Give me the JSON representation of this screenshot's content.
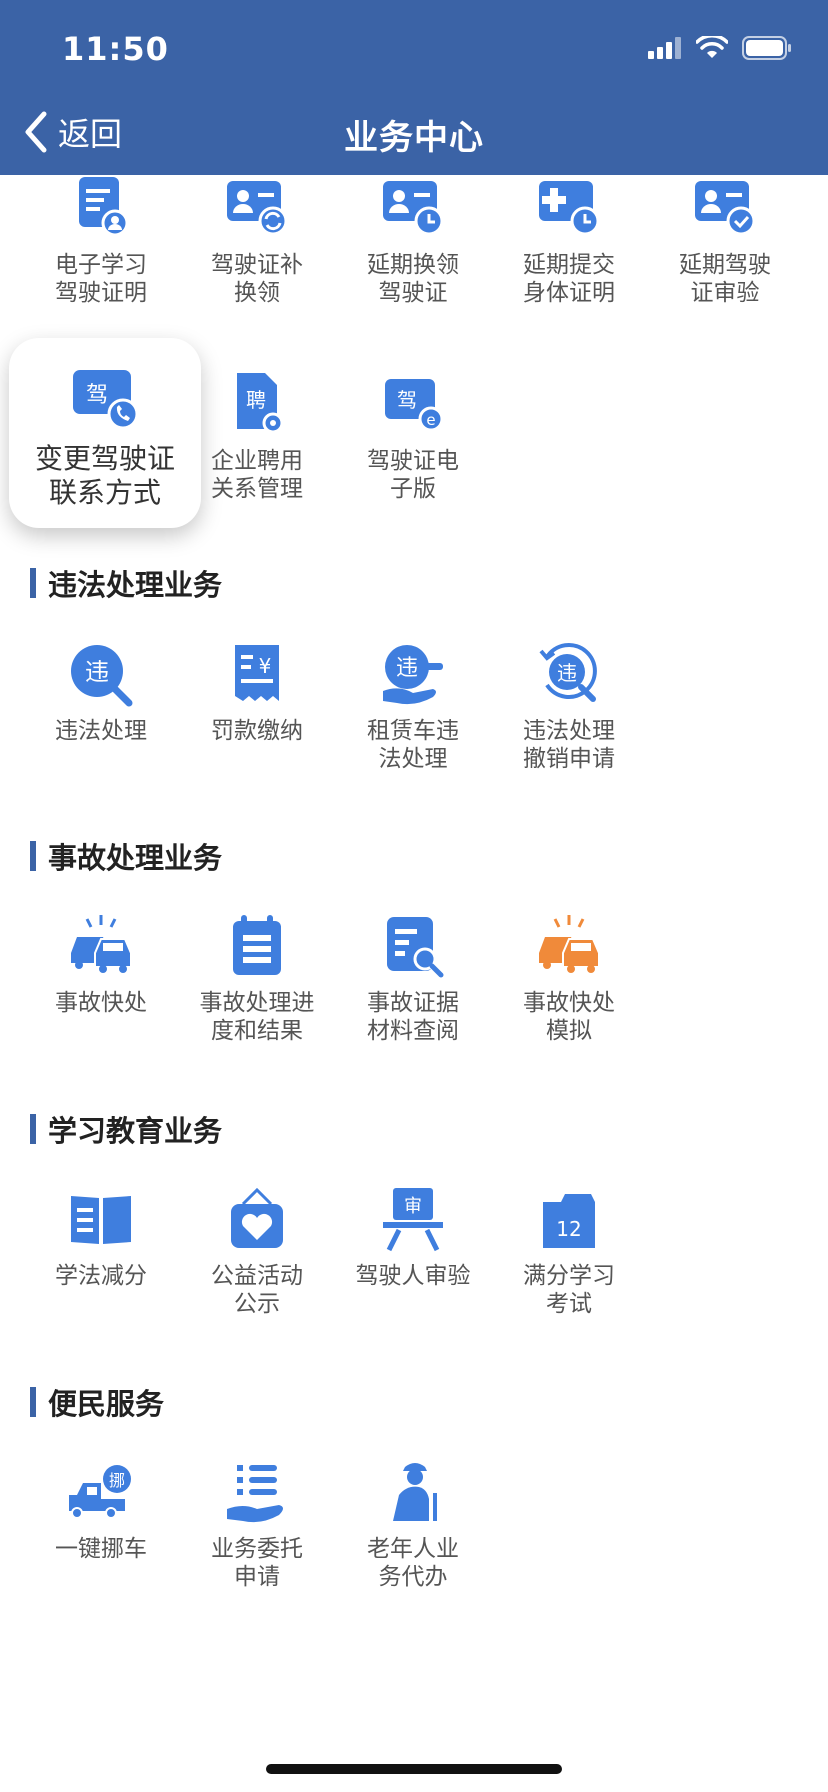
{
  "status_bar": {
    "time": "11:50"
  },
  "nav": {
    "back_label": "返回",
    "title": "业务中心"
  },
  "top_row": [
    {
      "label": "电子学习\n驾驶证明",
      "icon": "document-user-icon"
    },
    {
      "label": "驾驶证补\n换领",
      "icon": "license-refresh-icon"
    },
    {
      "label": "延期换领\n驾驶证",
      "icon": "license-clock-icon"
    },
    {
      "label": "延期提交\n身体证明",
      "icon": "medical-clock-icon"
    },
    {
      "label": "延期驾驶\n证审验",
      "icon": "license-check-icon"
    }
  ],
  "second_row": [
    {
      "label": "变更驾驶证\n联系方式",
      "icon": "license-phone-icon",
      "highlighted": true
    },
    {
      "label": "企业聘用\n关系管理",
      "icon": "hire-document-icon",
      "badge": "聘"
    },
    {
      "label": "驾驶证电\n子版",
      "icon": "e-license-icon",
      "badge": "驾"
    }
  ],
  "sections": [
    {
      "title": "违法处理业务",
      "items": [
        {
          "label": "违法处理",
          "icon": "violation-search-icon",
          "badge": "违"
        },
        {
          "label": "罚款缴纳",
          "icon": "fine-receipt-icon",
          "badge": "¥"
        },
        {
          "label": "租赁车违\n法处理",
          "icon": "rental-violation-icon",
          "badge": "违"
        },
        {
          "label": "违法处理\n撤销申请",
          "icon": "violation-revoke-icon",
          "badge": "违"
        }
      ]
    },
    {
      "title": "事故处理业务",
      "items": [
        {
          "label": "事故快处",
          "icon": "car-accident-icon"
        },
        {
          "label": "事故处理进\n度和结果",
          "icon": "calendar-progress-icon"
        },
        {
          "label": "事故证据\n材料查阅",
          "icon": "evidence-search-icon"
        },
        {
          "label": "事故快处\n模拟",
          "icon": "car-accident-orange-icon"
        }
      ]
    },
    {
      "title": "学习教育业务",
      "items": [
        {
          "label": "学法减分",
          "icon": "open-book-icon"
        },
        {
          "label": "公益活动\n公示",
          "icon": "charity-heart-icon"
        },
        {
          "label": "驾驶人审验",
          "icon": "review-easel-icon",
          "badge": "审"
        },
        {
          "label": "满分学习\n考试",
          "icon": "calendar-12-icon",
          "badge": "12"
        }
      ]
    },
    {
      "title": "便民服务",
      "items": [
        {
          "label": "一键挪车",
          "icon": "tow-truck-icon",
          "badge": "挪"
        },
        {
          "label": "业务委托\n申请",
          "icon": "delegate-list-icon"
        },
        {
          "label": "老年人业\n务代办",
          "icon": "elderly-person-icon"
        }
      ]
    }
  ],
  "colors": {
    "header_bg": "#3b63a6",
    "icon_blue": "#3f7ede",
    "icon_orange": "#f08a3a",
    "label_gray": "#555555"
  }
}
